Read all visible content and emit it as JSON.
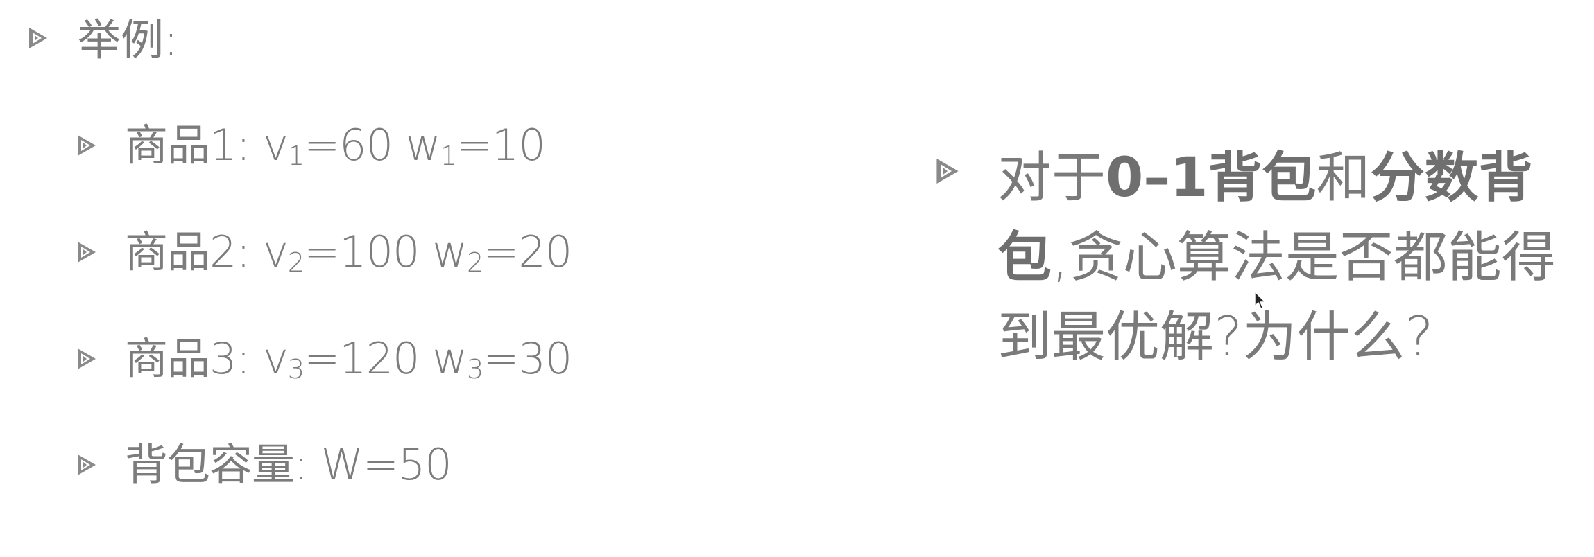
{
  "heading": "举例:",
  "items": [
    {
      "label": "商品1:",
      "v_sym": "v",
      "v_sub": "1",
      "v_val": "=60",
      "w_sym": "w",
      "w_sub": "1",
      "w_val": "=10"
    },
    {
      "label": "商品2:",
      "v_sym": "v",
      "v_sub": "2",
      "v_val": "=100",
      "w_sym": "w",
      "w_sub": "2",
      "w_val": "=20"
    },
    {
      "label": "商品3:",
      "v_sym": "v",
      "v_sub": "3",
      "v_val": "=120",
      "w_sym": "w",
      "w_sub": "3",
      "w_val": "=30"
    }
  ],
  "capacity": {
    "label": "背包容量:",
    "value": "W=50"
  },
  "question": {
    "prefix": "对于",
    "bold1": "0–1背包",
    "mid": "和",
    "bold2": "分数背包",
    "suffix": ",贪心算法是否都能得到最优解?为什么?"
  }
}
